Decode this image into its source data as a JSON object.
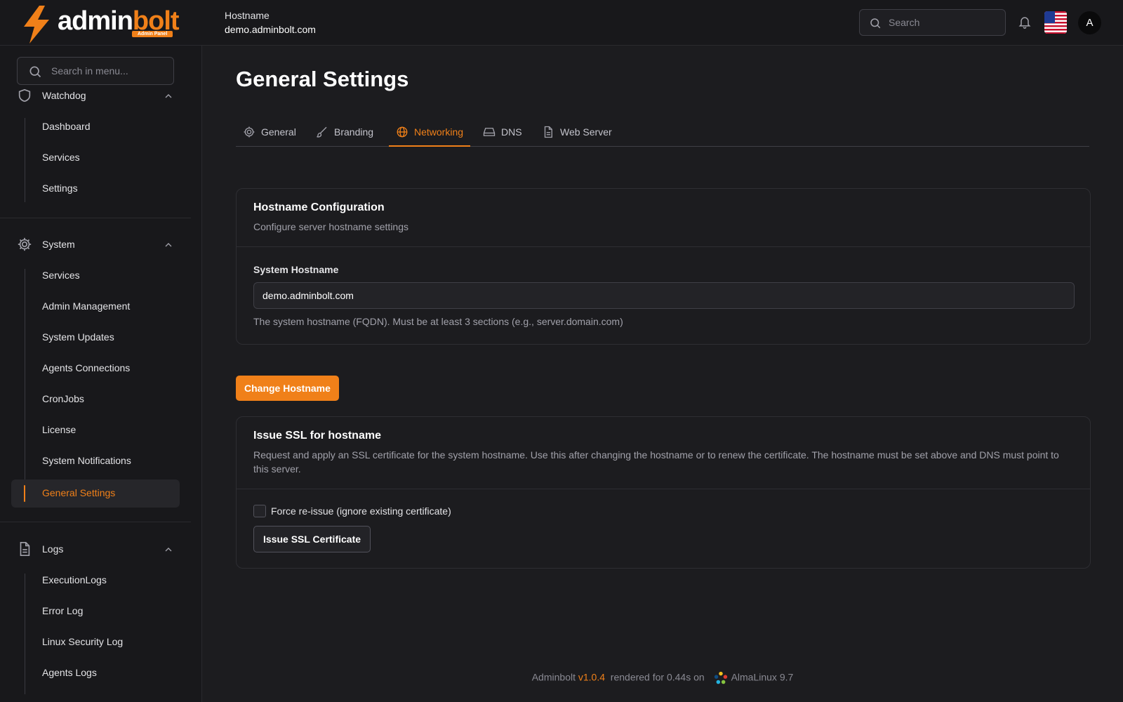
{
  "brand": {
    "name_part1": "admin",
    "name_part2": "bolt",
    "badge": "Admin Panel",
    "accent_color": "#f08019"
  },
  "header": {
    "hostname_label": "Hostname",
    "hostname_value": "demo.adminbolt.com",
    "search_placeholder": "Search",
    "avatar_initial": "A",
    "icons": [
      "search-icon",
      "bell-icon",
      "us-flag-icon"
    ]
  },
  "sidebar": {
    "search_placeholder": "Search in menu...",
    "groups": [
      {
        "label": "Watchdog",
        "icon": "shield-icon",
        "expanded": true,
        "items": [
          "Dashboard",
          "Services",
          "Settings"
        ]
      },
      {
        "label": "System",
        "icon": "gear-icon",
        "expanded": true,
        "items": [
          "Services",
          "Admin Management",
          "System Updates",
          "Agents Connections",
          "CronJobs",
          "License",
          "System Notifications",
          "General Settings"
        ],
        "active_item": "General Settings"
      },
      {
        "label": "Logs",
        "icon": "document-icon",
        "expanded": true,
        "items": [
          "ExecutionLogs",
          "Error Log",
          "Linux Security Log",
          "Agents Logs"
        ]
      }
    ]
  },
  "main": {
    "title": "General Settings",
    "tabs": [
      {
        "label": "General",
        "icon": "gear-icon"
      },
      {
        "label": "Branding",
        "icon": "brush-icon"
      },
      {
        "label": "Networking",
        "icon": "globe-icon",
        "active": true
      },
      {
        "label": "DNS",
        "icon": "drive-icon"
      },
      {
        "label": "Web Server",
        "icon": "file-icon"
      }
    ],
    "hostname_card": {
      "title": "Hostname Configuration",
      "description": "Configure server hostname settings",
      "field_label": "System Hostname",
      "field_value": "demo.adminbolt.com",
      "help_text": "The system hostname (FQDN). Must be at least 3 sections (e.g., server.domain.com)"
    },
    "change_button": "Change Hostname",
    "ssl_card": {
      "title": "Issue SSL for hostname",
      "description": "Request and apply an SSL certificate for the system hostname. Use this after changing the hostname or to renew the certificate. The hostname must be set above and DNS must point to this server.",
      "checkbox_label": "Force re-issue (ignore existing certificate)",
      "checkbox_checked": false,
      "button": "Issue SSL Certificate"
    }
  },
  "footer": {
    "app": "Adminbolt",
    "version": "v1.0.4",
    "rendered": "rendered for 0.44s on",
    "os": "AlmaLinux 9.7"
  }
}
